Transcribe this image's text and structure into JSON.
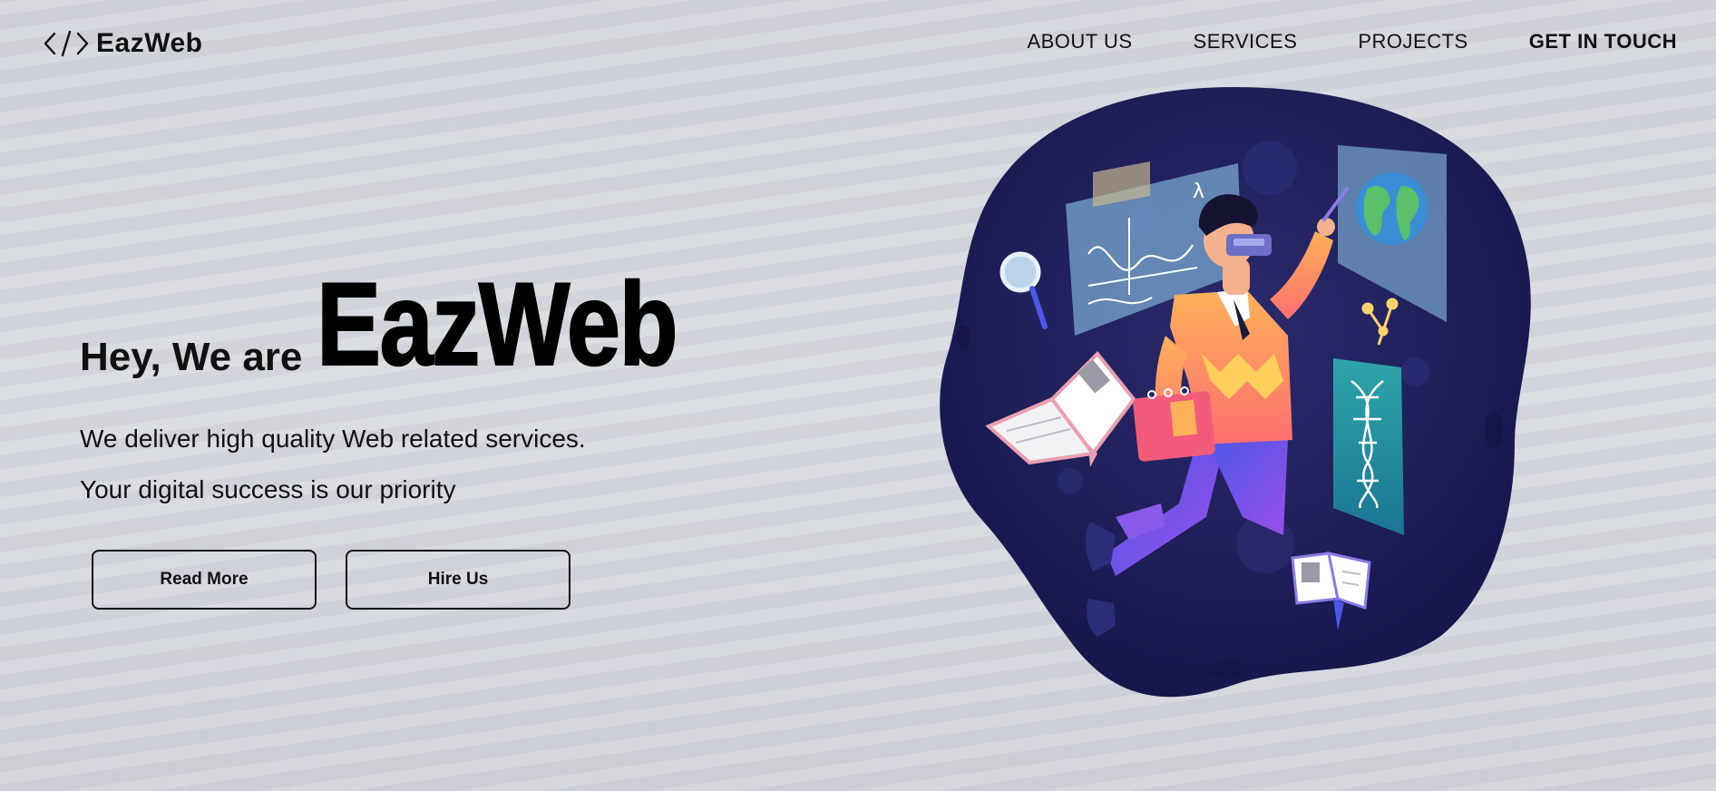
{
  "header": {
    "logo_text": "EazWeb",
    "nav": [
      {
        "label": "ABOUT US"
      },
      {
        "label": "SERVICES"
      },
      {
        "label": "PROJECTS"
      },
      {
        "label": "GET IN TOUCH"
      }
    ]
  },
  "hero": {
    "pre_title": "Hey, We are",
    "brand": "EazWeb",
    "tagline_1": "We deliver high quality Web related services.",
    "tagline_2": "Your digital success is our priority",
    "buttons": {
      "read_more": "Read More",
      "hire_us": "Hire Us"
    }
  },
  "illustration": {
    "graph_symbol": "λ"
  },
  "colors": {
    "background": "#d3d6dc",
    "blob": "#1a1a4e",
    "text": "#111111"
  },
  "icons": [
    "code-brackets-icon",
    "magnifier-icon",
    "globe-icon",
    "dna-icon",
    "book-icon",
    "notebook-icon"
  ]
}
